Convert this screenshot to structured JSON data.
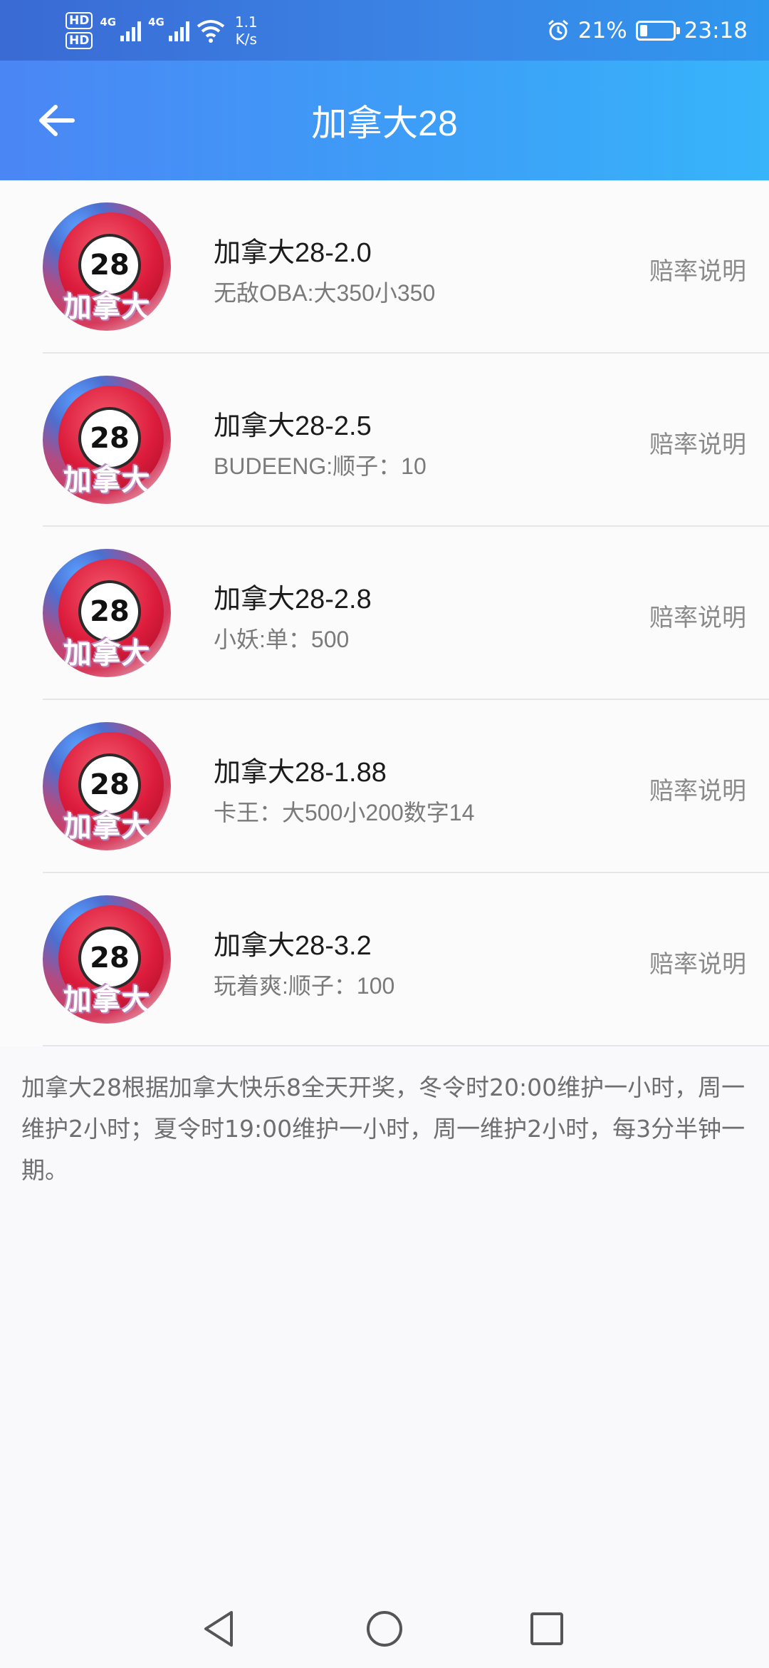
{
  "status_bar": {
    "hd1": "HD",
    "hd2": "HD",
    "net1": "4G",
    "net2": "4G",
    "speed_value": "1.1",
    "speed_unit": "K/s",
    "battery": "21%",
    "time": "23:18",
    "icons": [
      "hd-icon",
      "signal-icon",
      "wifi-icon",
      "alarm-icon",
      "battery-icon"
    ]
  },
  "header": {
    "title": "加拿大28",
    "back_icon": "back-arrow-icon",
    "accent": "#3d9ef7"
  },
  "items": [
    {
      "title": "加拿大28-2.0",
      "subtitle": "无敌OBA:大350小350",
      "link": "赔率说明",
      "avatar_number": "28",
      "avatar_caption": "加拿大"
    },
    {
      "title": "加拿大28-2.5",
      "subtitle": "BUDEENG:顺子：10",
      "link": "赔率说明",
      "avatar_number": "28",
      "avatar_caption": "加拿大"
    },
    {
      "title": "加拿大28-2.8",
      "subtitle": "小妖:单：500",
      "link": "赔率说明",
      "avatar_number": "28",
      "avatar_caption": "加拿大"
    },
    {
      "title": "加拿大28-1.88",
      "subtitle": "卡王：大500小200数字14",
      "link": "赔率说明",
      "avatar_number": "28",
      "avatar_caption": "加拿大"
    },
    {
      "title": "加拿大28-3.2",
      "subtitle": "玩着爽:顺子：100",
      "link": "赔率说明",
      "avatar_number": "28",
      "avatar_caption": "加拿大"
    }
  ],
  "note": "加拿大28根据加拿大快乐8全天开奖，冬令时20:00维护一小时，周一维护2小时；夏令时19:00维护一小时，周一维护2小时，每3分半钟一期。",
  "nav": {
    "icons": [
      "nav-back-icon",
      "nav-home-icon",
      "nav-recents-icon"
    ]
  }
}
